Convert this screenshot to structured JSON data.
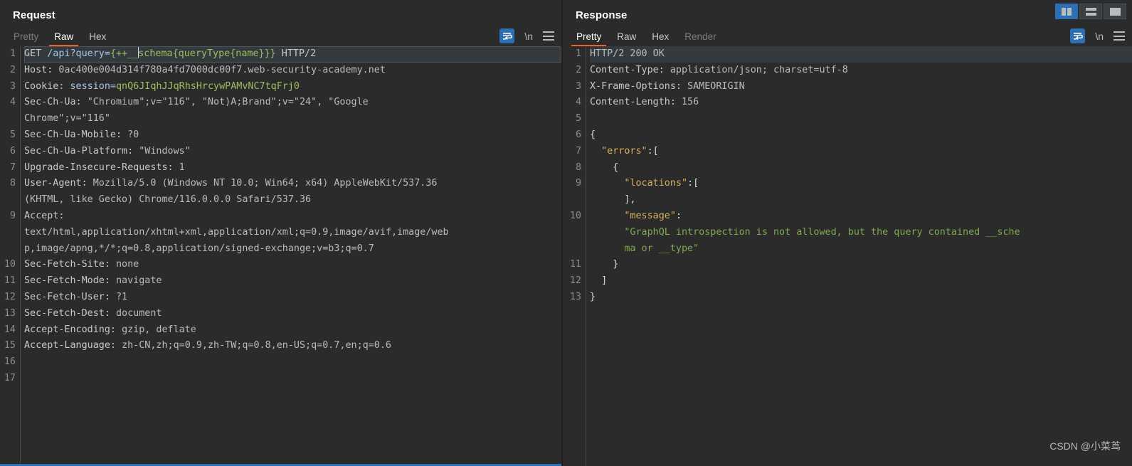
{
  "layout_switcher": {
    "buttons": [
      {
        "name": "side-by-side-layout",
        "label": "",
        "active": true
      },
      {
        "name": "stacked-layout",
        "label": "",
        "active": false
      },
      {
        "name": "single-pane-layout",
        "label": "",
        "active": false
      }
    ]
  },
  "request": {
    "title": "Request",
    "tabs": [
      {
        "label": "Pretty",
        "state": "dim"
      },
      {
        "label": "Raw",
        "state": "active"
      },
      {
        "label": "Hex",
        "state": "normal"
      }
    ],
    "tools": {
      "wrap_icon": "word-wrap-icon",
      "newline_label": "\\n",
      "menu_icon": "hamburger-menu-icon"
    },
    "line_numbers": [
      "1",
      "2",
      "3",
      "4",
      "",
      "5",
      "6",
      "7",
      "8",
      "",
      "9",
      "",
      "",
      "10",
      "11",
      "12",
      "13",
      "14",
      "15",
      "16",
      "17"
    ],
    "lines": [
      {
        "n": 1,
        "highlight": true,
        "segments": [
          {
            "t": "GET ",
            "c": "c-plain"
          },
          {
            "t": "/api?query=",
            "c": "c-key"
          },
          {
            "t": "{++__",
            "c": "c-green"
          },
          {
            "t": "CARET",
            "c": "caret"
          },
          {
            "t": "schema{queryType{name}}}",
            "c": "c-green"
          },
          {
            "t": " HTTP/2",
            "c": "c-plain"
          }
        ]
      },
      {
        "n": 2,
        "segments": [
          {
            "t": "Host: ",
            "c": "c-plain"
          },
          {
            "t": "0ac400e004d314f780a4fd7000dc00f7.web-security-academy.net",
            "c": "c-val"
          }
        ]
      },
      {
        "n": 3,
        "segments": [
          {
            "t": "Cookie: ",
            "c": "c-plain"
          },
          {
            "t": "session=",
            "c": "c-key"
          },
          {
            "t": "qnQ6JIqhJJqRhsHrcywPAMvNC7tqFrj0",
            "c": "c-green"
          }
        ]
      },
      {
        "n": 4,
        "segments": [
          {
            "t": "Sec-Ch-Ua: ",
            "c": "c-plain"
          },
          {
            "t": "\"Chromium\";v=\"116\", \"Not)A;Brand\";v=\"24\", \"Google",
            "c": "c-val"
          }
        ]
      },
      {
        "n": null,
        "segments": [
          {
            "t": "Chrome\";v=\"116\"",
            "c": "c-val"
          }
        ]
      },
      {
        "n": 5,
        "segments": [
          {
            "t": "Sec-Ch-Ua-Mobile: ",
            "c": "c-plain"
          },
          {
            "t": "?0",
            "c": "c-val"
          }
        ]
      },
      {
        "n": 6,
        "segments": [
          {
            "t": "Sec-Ch-Ua-Platform: ",
            "c": "c-plain"
          },
          {
            "t": "\"Windows\"",
            "c": "c-val"
          }
        ]
      },
      {
        "n": 7,
        "segments": [
          {
            "t": "Upgrade-Insecure-Requests: ",
            "c": "c-plain"
          },
          {
            "t": "1",
            "c": "c-val"
          }
        ]
      },
      {
        "n": 8,
        "segments": [
          {
            "t": "User-Agent: ",
            "c": "c-plain"
          },
          {
            "t": "Mozilla/5.0 (Windows NT 10.0; Win64; x64) AppleWebKit/537.36",
            "c": "c-val"
          }
        ]
      },
      {
        "n": null,
        "segments": [
          {
            "t": "(KHTML, like Gecko) Chrome/116.0.0.0 Safari/537.36",
            "c": "c-val"
          }
        ]
      },
      {
        "n": 9,
        "segments": [
          {
            "t": "Accept:",
            "c": "c-plain"
          }
        ]
      },
      {
        "n": null,
        "segments": [
          {
            "t": "text/html,application/xhtml+xml,application/xml;q=0.9,image/avif,image/web",
            "c": "c-val"
          }
        ]
      },
      {
        "n": null,
        "segments": [
          {
            "t": "p,image/apng,*/*;q=0.8,application/signed-exchange;v=b3;q=0.7",
            "c": "c-val"
          }
        ]
      },
      {
        "n": 10,
        "segments": [
          {
            "t": "Sec-Fetch-Site: ",
            "c": "c-plain"
          },
          {
            "t": "none",
            "c": "c-val"
          }
        ]
      },
      {
        "n": 11,
        "segments": [
          {
            "t": "Sec-Fetch-Mode: ",
            "c": "c-plain"
          },
          {
            "t": "navigate",
            "c": "c-val"
          }
        ]
      },
      {
        "n": 12,
        "segments": [
          {
            "t": "Sec-Fetch-User: ",
            "c": "c-plain"
          },
          {
            "t": "?1",
            "c": "c-val"
          }
        ]
      },
      {
        "n": 13,
        "segments": [
          {
            "t": "Sec-Fetch-Dest: ",
            "c": "c-plain"
          },
          {
            "t": "document",
            "c": "c-val"
          }
        ]
      },
      {
        "n": 14,
        "segments": [
          {
            "t": "Accept-Encoding: ",
            "c": "c-plain"
          },
          {
            "t": "gzip, deflate",
            "c": "c-val"
          }
        ]
      },
      {
        "n": 15,
        "segments": [
          {
            "t": "Accept-Language: ",
            "c": "c-plain"
          },
          {
            "t": "zh-CN,zh;q=0.9,zh-TW;q=0.8,en-US;q=0.7,en;q=0.6",
            "c": "c-val"
          }
        ]
      },
      {
        "n": 16,
        "segments": []
      },
      {
        "n": 17,
        "segments": []
      }
    ]
  },
  "response": {
    "title": "Response",
    "tabs": [
      {
        "label": "Pretty",
        "state": "active"
      },
      {
        "label": "Raw",
        "state": "normal"
      },
      {
        "label": "Hex",
        "state": "normal"
      },
      {
        "label": "Render",
        "state": "dim"
      }
    ],
    "tools": {
      "wrap_icon": "word-wrap-icon",
      "newline_label": "\\n",
      "menu_icon": "hamburger-menu-icon"
    },
    "lines": [
      {
        "n": 1,
        "highlight": true,
        "segments": [
          {
            "t": "HTTP/2 200 OK",
            "c": "c-val"
          }
        ]
      },
      {
        "n": 2,
        "segments": [
          {
            "t": "Content-Type: ",
            "c": "c-plain"
          },
          {
            "t": "application/json; charset=utf-8",
            "c": "c-val"
          }
        ]
      },
      {
        "n": 3,
        "segments": [
          {
            "t": "X-Frame-Options: ",
            "c": "c-plain"
          },
          {
            "t": "SAMEORIGIN",
            "c": "c-val"
          }
        ]
      },
      {
        "n": 4,
        "segments": [
          {
            "t": "Content-Length: ",
            "c": "c-plain"
          },
          {
            "t": "156",
            "c": "c-val"
          }
        ]
      },
      {
        "n": 5,
        "segments": []
      },
      {
        "n": 6,
        "segments": [
          {
            "t": "{",
            "c": "c-brack"
          }
        ]
      },
      {
        "n": 7,
        "segments": [
          {
            "t": "  ",
            "c": "c-plain"
          },
          {
            "t": "\"errors\"",
            "c": "c-jkey"
          },
          {
            "t": ":[",
            "c": "c-brack"
          }
        ]
      },
      {
        "n": 8,
        "segments": [
          {
            "t": "    {",
            "c": "c-brack"
          }
        ]
      },
      {
        "n": 9,
        "segments": [
          {
            "t": "      ",
            "c": "c-plain"
          },
          {
            "t": "\"locations\"",
            "c": "c-jkey"
          },
          {
            "t": ":[",
            "c": "c-brack"
          }
        ]
      },
      {
        "n": null,
        "segments": [
          {
            "t": "      ],",
            "c": "c-brack"
          }
        ]
      },
      {
        "n": 10,
        "segments": [
          {
            "t": "      ",
            "c": "c-plain"
          },
          {
            "t": "\"message\"",
            "c": "c-jkey"
          },
          {
            "t": ":",
            "c": "c-brack"
          }
        ]
      },
      {
        "n": null,
        "segments": [
          {
            "t": "      \"GraphQL introspection is not allowed, but the query contained __sche",
            "c": "c-jstr"
          }
        ]
      },
      {
        "n": null,
        "segments": [
          {
            "t": "      ma or __type\"",
            "c": "c-jstr"
          }
        ]
      },
      {
        "n": 11,
        "segments": [
          {
            "t": "    }",
            "c": "c-brack"
          }
        ]
      },
      {
        "n": 12,
        "segments": [
          {
            "t": "  ]",
            "c": "c-brack"
          }
        ]
      },
      {
        "n": 13,
        "segments": [
          {
            "t": "}",
            "c": "c-brack"
          }
        ]
      }
    ]
  },
  "watermark": "CSDN @小菜茑",
  "colors": {
    "accent_orange": "#e8642a",
    "accent_blue": "#2c6fb5",
    "background": "#2b2b2b",
    "json_key": "#d9b05e",
    "json_string": "#7ea94f"
  }
}
